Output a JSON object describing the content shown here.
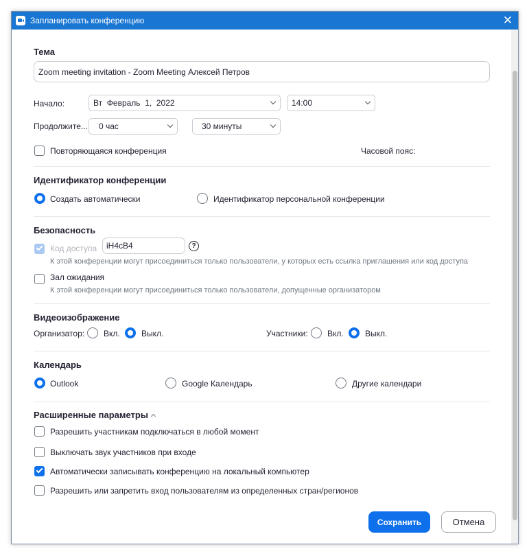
{
  "window": {
    "title": "Запланировать конференцию",
    "close_glyph": "✕"
  },
  "topic": {
    "heading": "Тема",
    "value": "Zoom meeting invitation - Zoom Meeting Алексей Петров"
  },
  "start": {
    "label": "Начало:",
    "date": "Вт  Февраль  1,  2022",
    "time": "14:00"
  },
  "duration": {
    "label": "Продолжите...",
    "hours": "0 час",
    "minutes": "30 минуты"
  },
  "recurring": {
    "label": "Повторяющаяся конференция",
    "checked": false
  },
  "timezone": {
    "label": "Часовой пояс:"
  },
  "meeting_id": {
    "heading": "Идентификатор конференции",
    "options": [
      {
        "label": "Создать автоматически",
        "selected": true
      },
      {
        "label": "Идентификатор персональной конференции",
        "selected": false
      }
    ]
  },
  "security": {
    "heading": "Безопасность",
    "passcode": {
      "label": "Код доступа",
      "value": "iH4cB4",
      "checked": true,
      "disabled": true,
      "hint": "К этой конференции могут присоединиться только пользователи, у которых есть ссылка приглашения или код доступа"
    },
    "help_glyph": "?",
    "waiting_room": {
      "label": "Зал ожидания",
      "checked": false,
      "hint": "К этой конференции могут присоединиться только пользователи, допущенные организатором"
    }
  },
  "video": {
    "heading": "Видеоизображение",
    "host": {
      "label": "Организатор:",
      "on": "Вкл.",
      "off": "Выкл.",
      "selected": "off"
    },
    "participants": {
      "label": "Участники:",
      "on": "Вкл.",
      "off": "Выкл.",
      "selected": "off"
    }
  },
  "calendar": {
    "heading": "Календарь",
    "options": [
      {
        "label": "Outlook",
        "selected": true
      },
      {
        "label": "Google Календарь",
        "selected": false
      },
      {
        "label": "Другие календари",
        "selected": false
      }
    ]
  },
  "advanced": {
    "heading": "Расширенные параметры",
    "options": [
      {
        "label": "Разрешить участникам подключаться в любой момент",
        "checked": false
      },
      {
        "label": "Выключать звук участников при входе",
        "checked": false
      },
      {
        "label": "Автоматически записывать конференцию на локальный компьютер",
        "checked": true
      },
      {
        "label": "Разрешить или запретить вход пользователям из определенных стран/регионов",
        "checked": false
      }
    ]
  },
  "buttons": {
    "save": "Сохранить",
    "cancel": "Отмена"
  },
  "colors": {
    "titlebar": "#1976d2",
    "accent": "#0e71eb"
  }
}
